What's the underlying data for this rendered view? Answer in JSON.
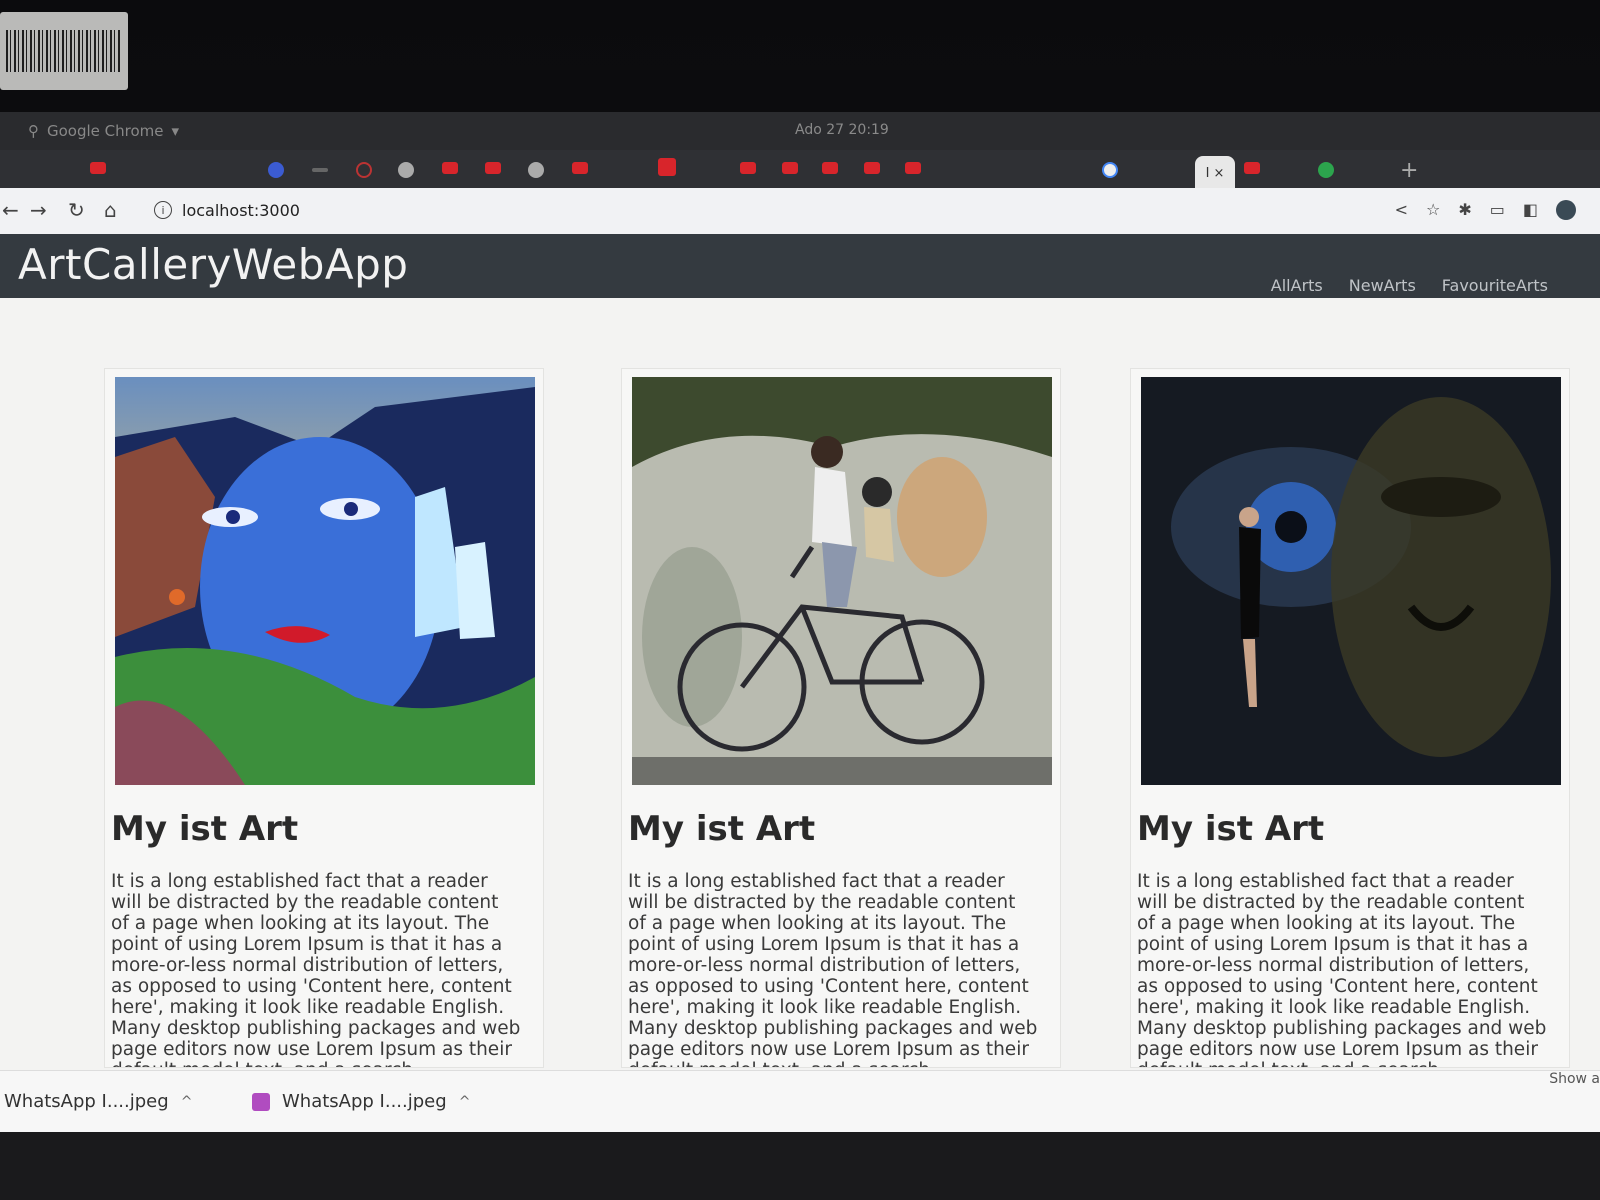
{
  "system": {
    "app_label": "Google Chrome",
    "clock": "Ado 27  20:19"
  },
  "browser": {
    "url": "localhost:3000",
    "active_tab_label": "I ×",
    "new_tab_symbol": "+"
  },
  "app": {
    "brand": "ArtCalleryWebApp",
    "nav": [
      "AllArts",
      "NewArts",
      "FavouriteArts"
    ]
  },
  "cards": [
    {
      "title": "My ist Art",
      "text": "It is a long established fact that a reader will be distracted by the readable content of a page when looking at its layout. The point of using Lorem Ipsum is that it has a more-or-less normal distribution of letters, as opposed to using 'Content here, content here', making it look like readable English. Many desktop publishing packages and web page editors now use Lorem Ipsum as their default model text, and a search",
      "image": "surreal-face-waterfall-painting"
    },
    {
      "title": "My ist Art",
      "text": "It is a long established fact that a reader will be distracted by the readable content of a page when looking at its layout. The point of using Lorem Ipsum is that it has a more-or-less normal distribution of letters, as opposed to using 'Content here, content here', making it look like readable English. Many desktop publishing packages and web page editors now use Lorem Ipsum as their default model text, and a search",
      "image": "children-on-bicycle-mural"
    },
    {
      "title": "My ist Art",
      "text": "It is a long established fact that a reader will be distracted by the readable content of a page when looking at its layout. The point of using Lorem Ipsum is that it has a more-or-less normal distribution of letters, as opposed to using 'Content here, content here', making it look like readable English. Many desktop publishing packages and web page editors now use Lorem Ipsum as their default model text, and a search",
      "image": "dark-eye-face-woman-artwork"
    }
  ],
  "downloads": {
    "items": [
      "WhatsApp I....jpeg",
      "WhatsApp I....jpeg"
    ],
    "show_all": "Show a"
  },
  "colors": {
    "navbar": "#343a40",
    "content_bg": "#f3f3f2",
    "tab_icon_red": "#d8252b"
  }
}
